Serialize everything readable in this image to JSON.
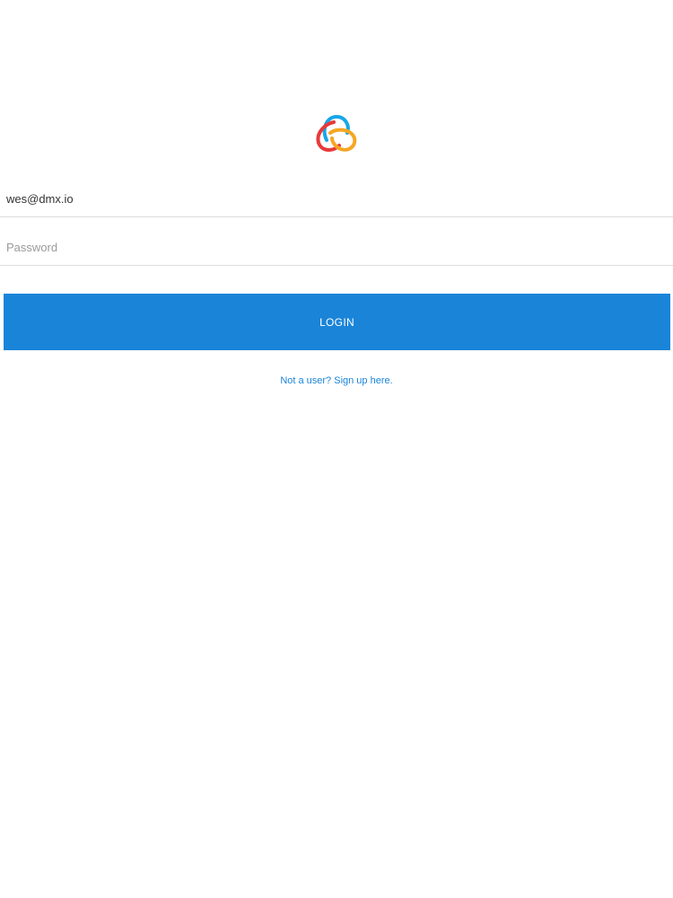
{
  "login_form": {
    "email_value": "wes@dmx.io",
    "password_placeholder": "Password",
    "login_label": "LOGIN",
    "signup_link": "Not a user? Sign up here."
  },
  "logo": {
    "icon": "app-logo-icon",
    "colors": [
      "#19a6e8",
      "#e83a3a",
      "#f5a623"
    ]
  },
  "accent_color": "#1a84d8"
}
